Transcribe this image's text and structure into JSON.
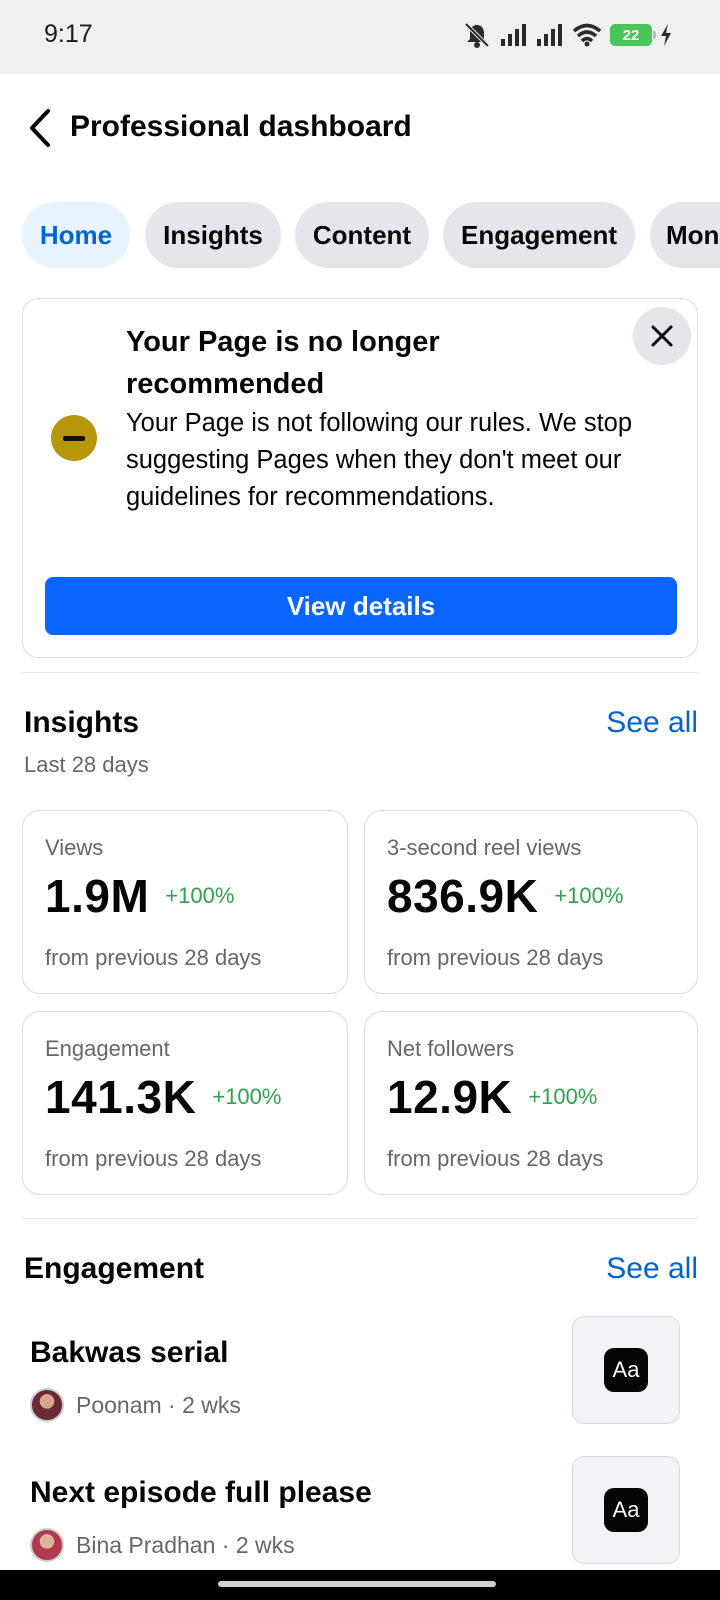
{
  "status_bar": {
    "time": "9:17",
    "battery": "22"
  },
  "header": {
    "title": "Professional dashboard"
  },
  "tabs": [
    {
      "label": "Home",
      "active": true
    },
    {
      "label": "Insights",
      "active": false
    },
    {
      "label": "Content",
      "active": false
    },
    {
      "label": "Engagement",
      "active": false
    },
    {
      "label": "Mon",
      "active": false
    }
  ],
  "notice": {
    "title": "Your Page is no longer recommended",
    "body": "Your Page is not following our rules. We stop suggesting Pages when they don't meet our guidelines for recommendations.",
    "button_label": "View details"
  },
  "insights": {
    "title": "Insights",
    "see_all": "See all",
    "subtitle": "Last 28 days",
    "metrics": [
      {
        "label": "Views",
        "value": "1.9M",
        "change": "+100%",
        "footnote": "from previous 28 days"
      },
      {
        "label": "3-second reel views",
        "value": "836.9K",
        "change": "+100%",
        "footnote": "from previous 28 days"
      },
      {
        "label": "Engagement",
        "value": "141.3K",
        "change": "+100%",
        "footnote": "from previous 28 days"
      },
      {
        "label": "Net followers",
        "value": "12.9K",
        "change": "+100%",
        "footnote": "from previous 28 days"
      }
    ]
  },
  "engagement": {
    "title": "Engagement",
    "see_all": "See all",
    "items": [
      {
        "title": "Bakwas serial",
        "meta": "Poonam · 2 wks",
        "thumb": "Aa"
      },
      {
        "title": "Next episode full please",
        "meta": "Bina Pradhan · 2 wks",
        "thumb": "Aa"
      }
    ]
  },
  "colors": {
    "accent": "#0866ff",
    "link": "#0064d1",
    "positive": "#31a24c",
    "warning": "#b8960a"
  }
}
